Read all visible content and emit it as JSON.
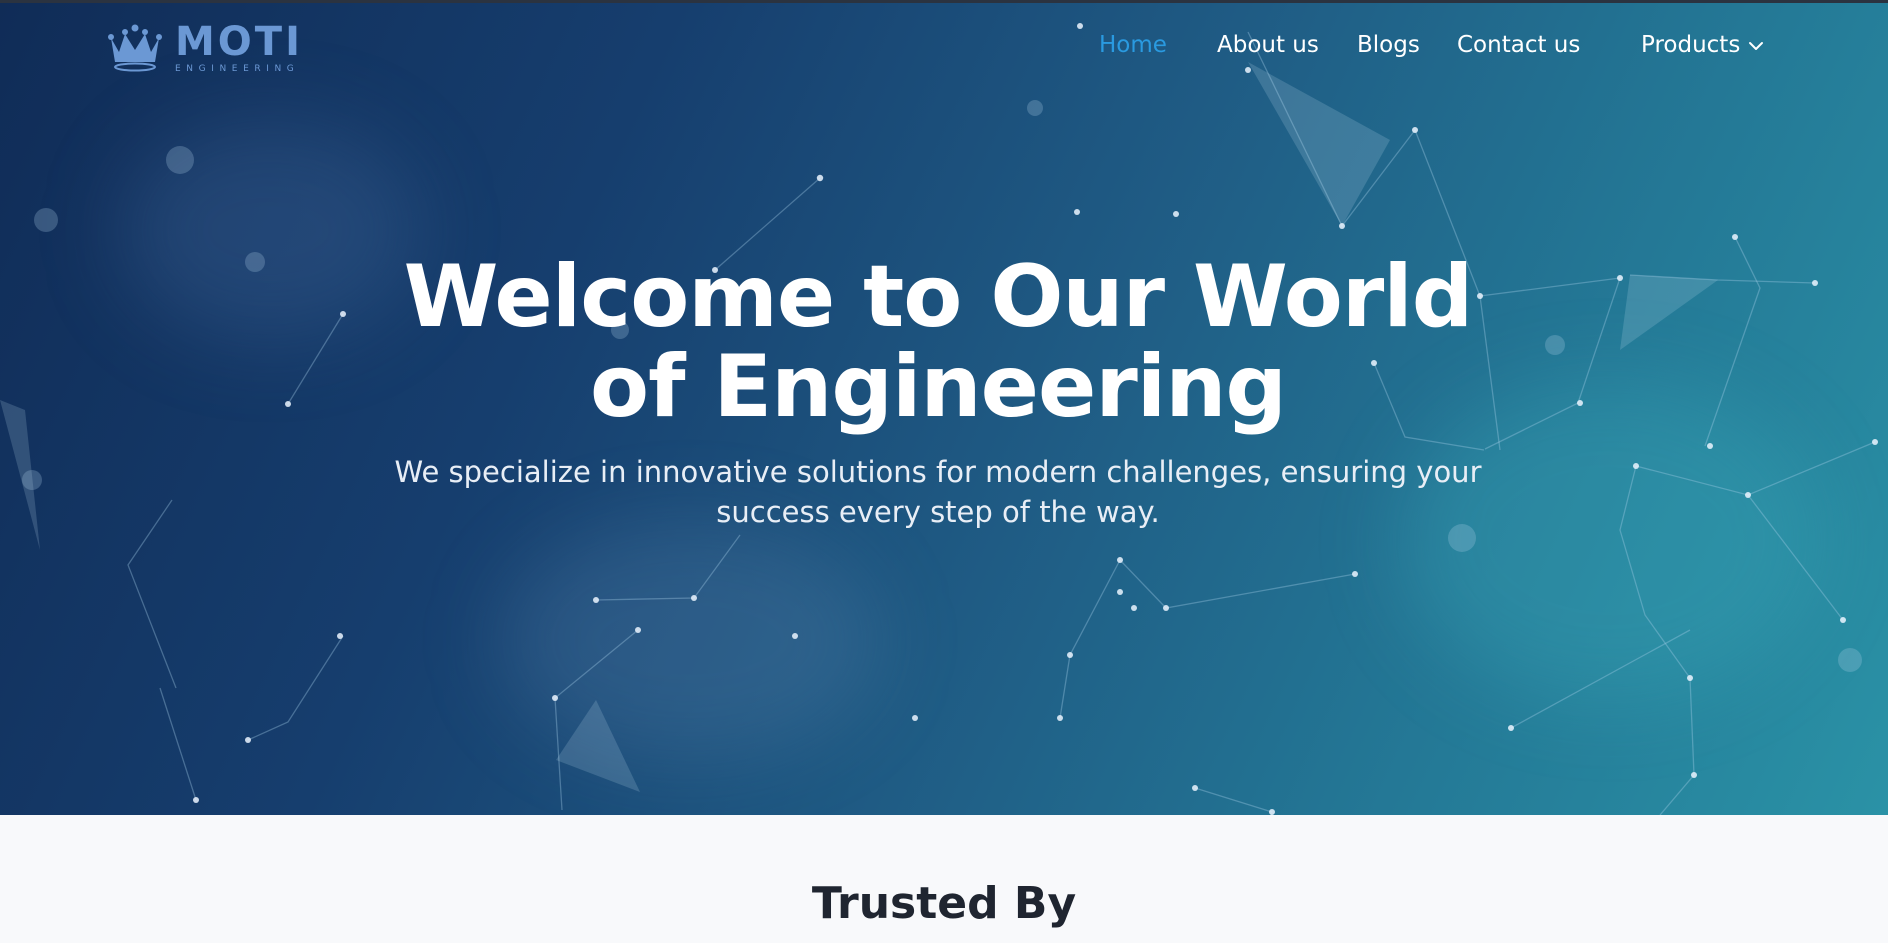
{
  "brand": {
    "name": "MOTI",
    "tagline": "ENGINEERING",
    "logo_icon": "crown-icon",
    "color": "#6b98d4"
  },
  "nav": {
    "items": [
      {
        "label": "Home",
        "active": true
      },
      {
        "label": "About us",
        "active": false
      },
      {
        "label": "Blogs",
        "active": false
      },
      {
        "label": "Contact us",
        "active": false
      },
      {
        "label": "Products",
        "active": false,
        "icon": "chevron-down-icon"
      }
    ],
    "active_color": "#2a9ae0"
  },
  "hero": {
    "title_line1": "Welcome to Our World",
    "title_line2": "of Engineering",
    "subtitle_line1": "We specialize in innovative solutions for modern challenges, ensuring your",
    "subtitle_line2": "success every step of the way.",
    "background": "network-constellation-image"
  },
  "section": {
    "trusted_title": "Trusted By"
  }
}
